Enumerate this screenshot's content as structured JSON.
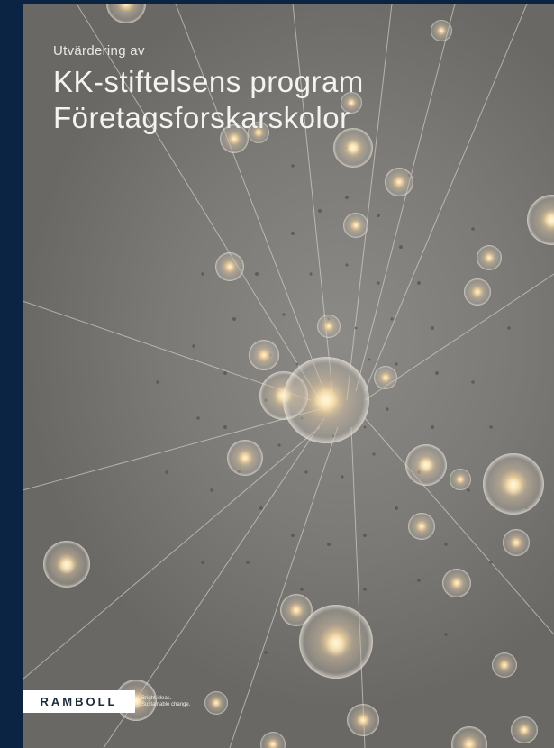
{
  "cover": {
    "pre_title": "Utvärdering av",
    "title_line1": "KK-stiftelsens program",
    "title_line2": "Företagsforskarskolor"
  },
  "logo": {
    "wordmark": "RAMBOLL",
    "tagline_line1": "Bright ideas.",
    "tagline_line2": "Sustainable change."
  },
  "colors": {
    "frame": "#0b2444",
    "background": "#7c7a76",
    "title_text": "#f4f3f0"
  }
}
